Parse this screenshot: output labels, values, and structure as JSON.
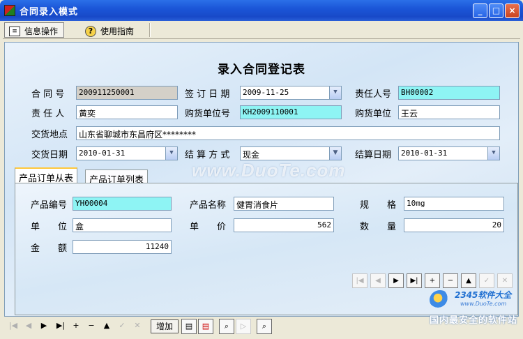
{
  "window": {
    "title": "合同录入模式",
    "buttons": {
      "minimize": "_",
      "maximize": "□",
      "close": "×"
    }
  },
  "menu": {
    "tabs": [
      {
        "label": "信息操作",
        "icon": "info-panel-icon",
        "active": true
      },
      {
        "label": "使用指南",
        "icon": "help-icon",
        "active": false
      }
    ]
  },
  "form": {
    "title": "录入合同登记表",
    "contract_no": {
      "label": "合 同 号",
      "value": "200911250001"
    },
    "sign_date": {
      "label": "签 订 日 期",
      "value": "2009-11-25"
    },
    "responsible_no": {
      "label": "责任人号",
      "value": "BH00002"
    },
    "responsible": {
      "label": "责 任 人",
      "value": "黄奕"
    },
    "buyer_no": {
      "label": "购货单位号",
      "value": "KH2009110001"
    },
    "buyer": {
      "label": "购货单位",
      "value": "王云"
    },
    "delivery_place": {
      "label": "交货地点",
      "value": "山东省聊城市东昌府区********"
    },
    "delivery_date": {
      "label": "交货日期",
      "value": "2010-01-31"
    },
    "settle_method": {
      "label": "结 算 方 式",
      "value": "现金"
    },
    "settle_date": {
      "label": "结算日期",
      "value": "2010-01-31"
    }
  },
  "inner_tabs": [
    "产品订单从表",
    "产品订单列表"
  ],
  "product": {
    "code": {
      "label": "产品编号",
      "value": "YH00004"
    },
    "name": {
      "label": "产品名称",
      "value": "健胃消食片"
    },
    "spec": {
      "label": "规　　格",
      "value": "10mg"
    },
    "unit": {
      "label": "单　　位",
      "value": "盒"
    },
    "price": {
      "label": "单　　价",
      "value": "562"
    },
    "qty": {
      "label": "数　　量",
      "value": "20"
    },
    "amount": {
      "label": "金　　额",
      "value": "11240"
    }
  },
  "record_nav": [
    "|◀",
    "◀",
    "▶",
    "▶|",
    "+",
    "−",
    "▲",
    "✓",
    "✕"
  ],
  "bottom_toolbar": {
    "add_label": "增加"
  },
  "watermark": "www.DuoTe.com",
  "brand": {
    "line1": "2345软件大全",
    "line2": "www.DuoTe.com",
    "slogan": "国内最安全的软件站"
  },
  "colors": {
    "title_bar": "#1b56d8",
    "highlight_field": "#8ef4f4",
    "readonly_field": "#d4d0c8"
  }
}
